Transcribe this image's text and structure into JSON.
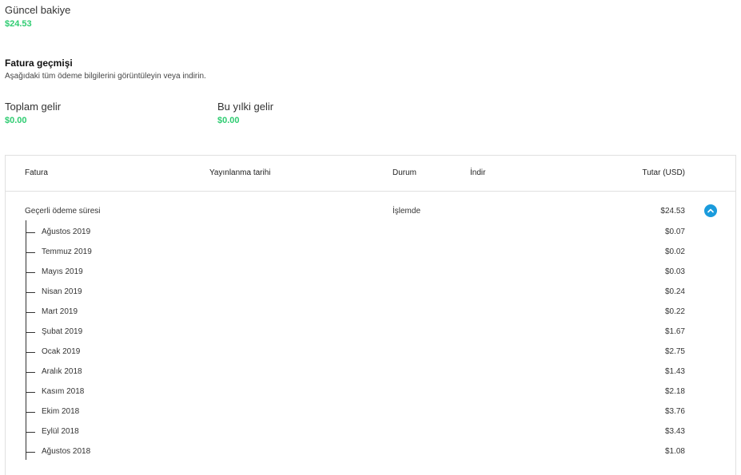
{
  "balance": {
    "label": "Güncel bakiye",
    "value": "$24.53"
  },
  "history": {
    "title": "Fatura geçmişi",
    "description": "Aşağıdaki tüm ödeme bilgilerini görüntüleyin veya indirin."
  },
  "stats": {
    "total": {
      "label": "Toplam gelir",
      "value": "$0.00"
    },
    "year": {
      "label": "Bu yılki gelir",
      "value": "$0.00"
    }
  },
  "table": {
    "headers": {
      "invoice": "Fatura",
      "date": "Yayınlanma tarihi",
      "status": "Durum",
      "download": "İndir",
      "amount": "Tutar (USD)"
    },
    "current": {
      "label": "Geçerli ödeme süresi",
      "status": "İşlemde",
      "amount": "$24.53"
    },
    "months": [
      {
        "label": "Ağustos 2019",
        "amount": "$0.07"
      },
      {
        "label": "Temmuz 2019",
        "amount": "$0.02"
      },
      {
        "label": "Mayıs 2019",
        "amount": "$0.03"
      },
      {
        "label": "Nisan 2019",
        "amount": "$0.24"
      },
      {
        "label": "Mart 2019",
        "amount": "$0.22"
      },
      {
        "label": "Şubat 2019",
        "amount": "$1.67"
      },
      {
        "label": "Ocak 2019",
        "amount": "$2.75"
      },
      {
        "label": "Aralık 2018",
        "amount": "$1.43"
      },
      {
        "label": "Kasım 2018",
        "amount": "$2.18"
      },
      {
        "label": "Ekim 2018",
        "amount": "$3.76"
      },
      {
        "label": "Eylül 2018",
        "amount": "$3.43"
      },
      {
        "label": "Ağustos 2018",
        "amount": "$1.08"
      }
    ]
  },
  "icons": {
    "toggle": "chevron-up-icon"
  },
  "colors": {
    "money": "#2ecc71",
    "accent": "#1a9bdc"
  }
}
